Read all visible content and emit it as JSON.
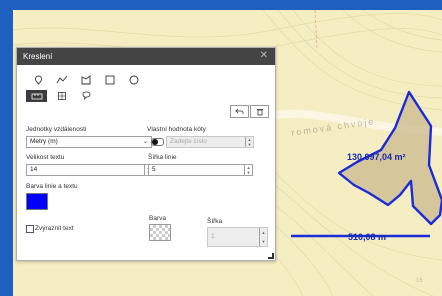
{
  "panel": {
    "title": "Kreslení",
    "tools": [
      "pin-icon",
      "polyline-icon",
      "polygon-icon",
      "rectangle-icon",
      "circle-icon",
      "distance-icon",
      "area-icon",
      "text-icon"
    ],
    "distance_units_label": "Jednotky vzdálenosti",
    "distance_units_value": "Metry (m)",
    "custom_dim_label": "Vlastní hodnota kóty",
    "custom_dim_placeholder": "Zadejte číslo",
    "text_size_label": "Velikost textu",
    "text_size_value": "14",
    "line_width_label": "Šířka linie",
    "line_width_value": "5",
    "line_text_color_label": "Barva linie a textu",
    "line_text_color": "#0000ff",
    "highlight_text_label": "Zvýraznit text",
    "fill_color_label": "Barva",
    "width_label": "Šířka",
    "width_value": "1"
  },
  "map": {
    "area_label": "130 097,04 m²",
    "distance_label": "510,08 m",
    "street_label": "romová chvoje",
    "street_number": "16"
  }
}
